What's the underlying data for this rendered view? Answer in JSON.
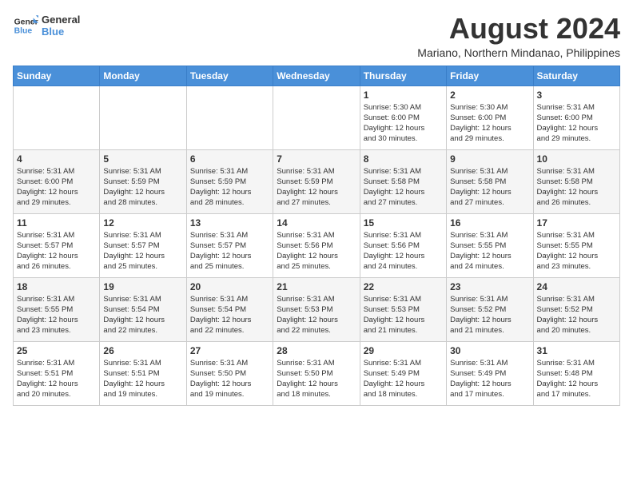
{
  "logo": {
    "line1": "General",
    "line2": "Blue"
  },
  "title": "August 2024",
  "location": "Mariano, Northern Mindanao, Philippines",
  "days_of_week": [
    "Sunday",
    "Monday",
    "Tuesday",
    "Wednesday",
    "Thursday",
    "Friday",
    "Saturday"
  ],
  "weeks": [
    [
      {
        "day": "",
        "info": ""
      },
      {
        "day": "",
        "info": ""
      },
      {
        "day": "",
        "info": ""
      },
      {
        "day": "",
        "info": ""
      },
      {
        "day": "1",
        "info": "Sunrise: 5:30 AM\nSunset: 6:00 PM\nDaylight: 12 hours\nand 30 minutes."
      },
      {
        "day": "2",
        "info": "Sunrise: 5:30 AM\nSunset: 6:00 PM\nDaylight: 12 hours\nand 29 minutes."
      },
      {
        "day": "3",
        "info": "Sunrise: 5:31 AM\nSunset: 6:00 PM\nDaylight: 12 hours\nand 29 minutes."
      }
    ],
    [
      {
        "day": "4",
        "info": "Sunrise: 5:31 AM\nSunset: 6:00 PM\nDaylight: 12 hours\nand 29 minutes."
      },
      {
        "day": "5",
        "info": "Sunrise: 5:31 AM\nSunset: 5:59 PM\nDaylight: 12 hours\nand 28 minutes."
      },
      {
        "day": "6",
        "info": "Sunrise: 5:31 AM\nSunset: 5:59 PM\nDaylight: 12 hours\nand 28 minutes."
      },
      {
        "day": "7",
        "info": "Sunrise: 5:31 AM\nSunset: 5:59 PM\nDaylight: 12 hours\nand 27 minutes."
      },
      {
        "day": "8",
        "info": "Sunrise: 5:31 AM\nSunset: 5:58 PM\nDaylight: 12 hours\nand 27 minutes."
      },
      {
        "day": "9",
        "info": "Sunrise: 5:31 AM\nSunset: 5:58 PM\nDaylight: 12 hours\nand 27 minutes."
      },
      {
        "day": "10",
        "info": "Sunrise: 5:31 AM\nSunset: 5:58 PM\nDaylight: 12 hours\nand 26 minutes."
      }
    ],
    [
      {
        "day": "11",
        "info": "Sunrise: 5:31 AM\nSunset: 5:57 PM\nDaylight: 12 hours\nand 26 minutes."
      },
      {
        "day": "12",
        "info": "Sunrise: 5:31 AM\nSunset: 5:57 PM\nDaylight: 12 hours\nand 25 minutes."
      },
      {
        "day": "13",
        "info": "Sunrise: 5:31 AM\nSunset: 5:57 PM\nDaylight: 12 hours\nand 25 minutes."
      },
      {
        "day": "14",
        "info": "Sunrise: 5:31 AM\nSunset: 5:56 PM\nDaylight: 12 hours\nand 25 minutes."
      },
      {
        "day": "15",
        "info": "Sunrise: 5:31 AM\nSunset: 5:56 PM\nDaylight: 12 hours\nand 24 minutes."
      },
      {
        "day": "16",
        "info": "Sunrise: 5:31 AM\nSunset: 5:55 PM\nDaylight: 12 hours\nand 24 minutes."
      },
      {
        "day": "17",
        "info": "Sunrise: 5:31 AM\nSunset: 5:55 PM\nDaylight: 12 hours\nand 23 minutes."
      }
    ],
    [
      {
        "day": "18",
        "info": "Sunrise: 5:31 AM\nSunset: 5:55 PM\nDaylight: 12 hours\nand 23 minutes."
      },
      {
        "day": "19",
        "info": "Sunrise: 5:31 AM\nSunset: 5:54 PM\nDaylight: 12 hours\nand 22 minutes."
      },
      {
        "day": "20",
        "info": "Sunrise: 5:31 AM\nSunset: 5:54 PM\nDaylight: 12 hours\nand 22 minutes."
      },
      {
        "day": "21",
        "info": "Sunrise: 5:31 AM\nSunset: 5:53 PM\nDaylight: 12 hours\nand 22 minutes."
      },
      {
        "day": "22",
        "info": "Sunrise: 5:31 AM\nSunset: 5:53 PM\nDaylight: 12 hours\nand 21 minutes."
      },
      {
        "day": "23",
        "info": "Sunrise: 5:31 AM\nSunset: 5:52 PM\nDaylight: 12 hours\nand 21 minutes."
      },
      {
        "day": "24",
        "info": "Sunrise: 5:31 AM\nSunset: 5:52 PM\nDaylight: 12 hours\nand 20 minutes."
      }
    ],
    [
      {
        "day": "25",
        "info": "Sunrise: 5:31 AM\nSunset: 5:51 PM\nDaylight: 12 hours\nand 20 minutes."
      },
      {
        "day": "26",
        "info": "Sunrise: 5:31 AM\nSunset: 5:51 PM\nDaylight: 12 hours\nand 19 minutes."
      },
      {
        "day": "27",
        "info": "Sunrise: 5:31 AM\nSunset: 5:50 PM\nDaylight: 12 hours\nand 19 minutes."
      },
      {
        "day": "28",
        "info": "Sunrise: 5:31 AM\nSunset: 5:50 PM\nDaylight: 12 hours\nand 18 minutes."
      },
      {
        "day": "29",
        "info": "Sunrise: 5:31 AM\nSunset: 5:49 PM\nDaylight: 12 hours\nand 18 minutes."
      },
      {
        "day": "30",
        "info": "Sunrise: 5:31 AM\nSunset: 5:49 PM\nDaylight: 12 hours\nand 17 minutes."
      },
      {
        "day": "31",
        "info": "Sunrise: 5:31 AM\nSunset: 5:48 PM\nDaylight: 12 hours\nand 17 minutes."
      }
    ]
  ]
}
